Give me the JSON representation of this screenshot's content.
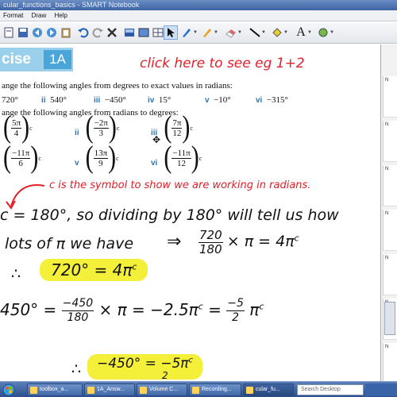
{
  "window": {
    "title": "cular_functions_basics - SMART Notebook"
  },
  "menu": [
    "Format",
    "Draw",
    "Help"
  ],
  "toolbar": {
    "icons": [
      "page-icon",
      "save-icon",
      "prev-page-icon",
      "next-page-icon",
      "paste-icon",
      "undo-icon",
      "redo-icon",
      "delete-icon",
      "screen-shade-icon",
      "full-screen-icon",
      "table-icon",
      "select-icon",
      "pen-icon",
      "creative-pen-icon",
      "eraser-icon",
      "line-icon",
      "fill-icon",
      "text-icon",
      "properties-icon"
    ],
    "text_tool_glyph": "A"
  },
  "exercise": {
    "word": "cise",
    "number": "1A"
  },
  "q1": {
    "prompt": "ange the following angles from degrees to exact values in radians:",
    "items": [
      {
        "label": "",
        "value": "720°"
      },
      {
        "label": "ii",
        "value": "540°"
      },
      {
        "label": "iii",
        "value": "−450°"
      },
      {
        "label": "iv",
        "value": "15°"
      },
      {
        "label": "v",
        "value": "−10°"
      },
      {
        "label": "vi",
        "value": "−315°"
      }
    ]
  },
  "q2": {
    "prompt": "ange the following angles from radians to degrees:",
    "row1": [
      {
        "label": "",
        "num": "5π",
        "den": "4",
        "sup": "c"
      },
      {
        "label": "ii",
        "num": "−2π",
        "den": "3",
        "sup": "c"
      },
      {
        "label": "iii",
        "num": "7π",
        "den": "12",
        "sup": "c"
      }
    ],
    "row2": [
      {
        "label": "",
        "num": "−11π",
        "den": "6",
        "sup": "c"
      },
      {
        "label": "v",
        "num": "13π",
        "den": "9",
        "sup": "c"
      },
      {
        "label": "vi",
        "num": "−11π",
        "den": "12",
        "sup": "c"
      }
    ]
  },
  "handwriting": {
    "click_note": "click here to see eg 1+2",
    "c_note": "c is the symbol to show we are working in radians.",
    "line1": "c = 180°, so dividing by 180° will tell us how",
    "line2": "lots of π we have",
    "arrow_eq": "⇒",
    "eq1_num": "720",
    "eq1_den": "180",
    "eq1_rest": "× π = 4π",
    "eq1_sup": "c",
    "therefore1": "∴",
    "boxed1": "720° = 4π",
    "boxed1_sup": "c",
    "line3_start": "450°",
    "line3_eq": "=",
    "line3_num": "−450",
    "line3_den": "180",
    "line3_mid": "× π = −2.5π",
    "line3_sup": "c",
    "line3_eq2": "=",
    "line3_num2": "−5",
    "line3_den2": "2",
    "line3_pi": "π",
    "line3_sup2": "c",
    "therefore2": "∴",
    "boxed2": "−450° = −5π",
    "boxed2_sup": "c",
    "boxed2_den": "2"
  },
  "sidebar": {
    "items": [
      "N",
      "N",
      "N",
      "N",
      "N",
      "N",
      "N"
    ]
  },
  "taskbar": {
    "tasks": [
      "toolbox_a...",
      "1A_Answ...",
      "Volume C...",
      "Recording...",
      "cular_fu..."
    ],
    "search_placeholder": "Search Desktop"
  },
  "colors": {
    "accent": "#4aa6d9",
    "ink_red": "#e0202a",
    "highlight": "#f4f03a"
  }
}
